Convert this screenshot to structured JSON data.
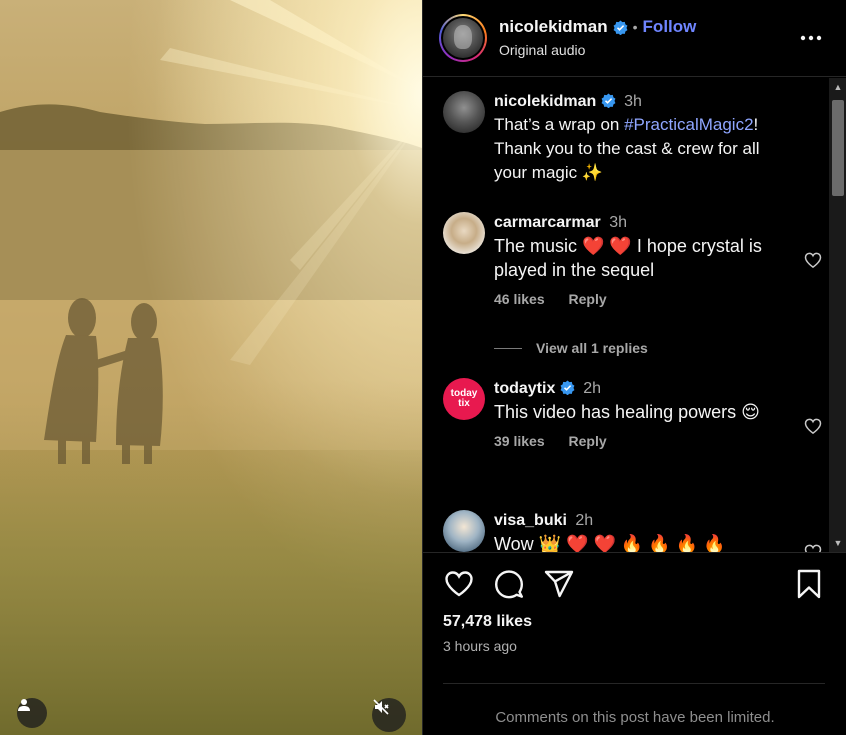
{
  "post": {
    "username": "nicolekidman",
    "separator": "•",
    "follow_label": "Follow",
    "audio_label": "Original audio",
    "likes_text": "57,478 likes",
    "time_ago": "3 hours ago",
    "comments_limited_text": "Comments on this post have been limited."
  },
  "caption": {
    "username": "nicolekidman",
    "time": "3h",
    "text_before": "That’s a wrap on ",
    "hashtag": "#PracticalMagic2",
    "text_after": "! Thank you to the cast & crew for all your magic ✨"
  },
  "comments": [
    {
      "username": "carmarcarmar",
      "time": "3h",
      "text": "The music ❤️ ❤️ I hope crystal is played in the sequel",
      "likes": "46 likes",
      "reply_label": "Reply",
      "replies_label": "View all 1 replies"
    },
    {
      "username": "todaytix",
      "time": "2h",
      "text": "This video has healing powers 😌",
      "likes": "39 likes",
      "reply_label": "Reply",
      "avatar_text": "today tix"
    },
    {
      "username": "visa_buki",
      "time": "2h",
      "text": "Wow 👑 ❤️ ❤️ 🔥 🔥 🔥 🔥"
    }
  ],
  "icons": {
    "verified": "verified-badge-icon",
    "more": "more-options-icon",
    "like": "heart-icon",
    "comment": "comment-bubble-icon",
    "share": "paper-plane-icon",
    "save": "bookmark-icon",
    "user_tag": "user-tag-icon",
    "mute": "speaker-muted-icon"
  },
  "colors": {
    "follow": "#6f85ff",
    "hashtag": "#8fa6ff",
    "verified": "#3897f0",
    "todaytix_brand": "#e8194f"
  }
}
